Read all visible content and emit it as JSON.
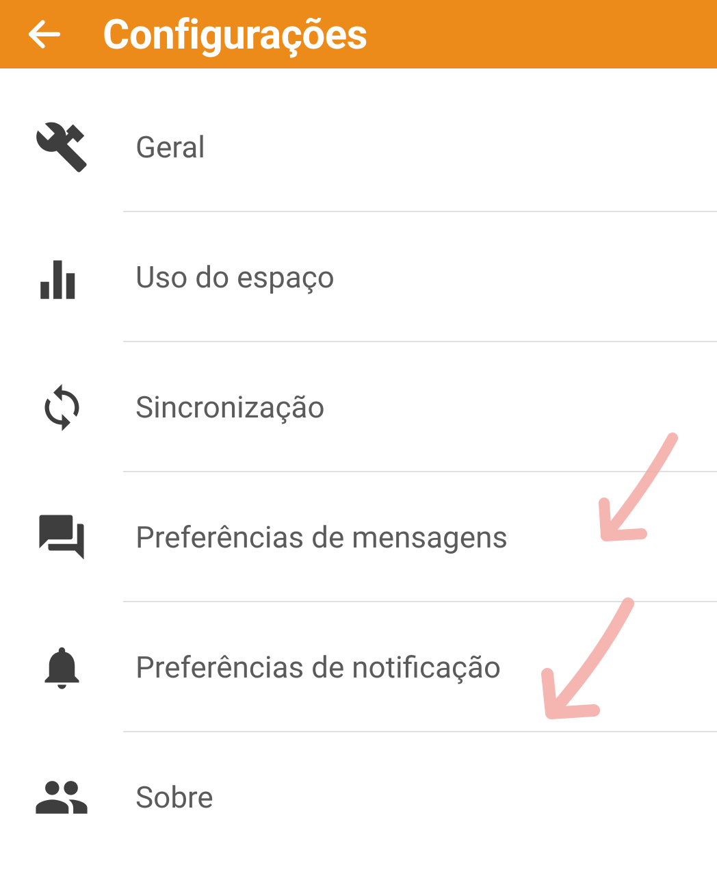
{
  "header": {
    "title": "Configurações"
  },
  "menu": {
    "items": [
      {
        "label": "Geral"
      },
      {
        "label": "Uso do espaço"
      },
      {
        "label": "Sincronização"
      },
      {
        "label": "Preferências de mensagens"
      },
      {
        "label": "Preferências de notificação"
      },
      {
        "label": "Sobre"
      }
    ]
  },
  "colors": {
    "accent": "#ed8b1a",
    "icon": "#3e3e3e",
    "text": "#5b5b5b",
    "annotation": "#f4a9a3"
  }
}
